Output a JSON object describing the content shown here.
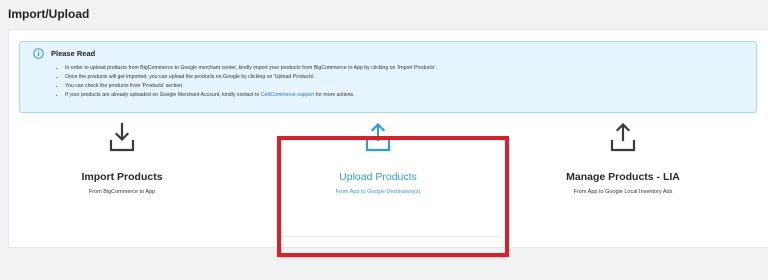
{
  "page": {
    "title": "Import/Upload"
  },
  "notice": {
    "title": "Please Read",
    "items": [
      {
        "text": "In order to upload products from BigCommerce to Google merchant center, kindly import your products from BigCommerce to App by clicking on 'Import Products'."
      },
      {
        "text": "Once the products will get imported, you can upload the products on Google by clicking on 'Upload Products'."
      },
      {
        "text": "You can check the products from 'Products' section."
      },
      {
        "text_before": "If your products are already uploaded on Google Merchant Account, kindly contact to ",
        "link": "CedCommerce support",
        "text_after": " for more actions."
      }
    ]
  },
  "actions": {
    "import": {
      "title": "Import Products",
      "subtitle": "From BigCommerce to App"
    },
    "upload": {
      "title": "Upload Products",
      "subtitle": "From App to Google Destination(s)"
    },
    "manage": {
      "title": "Manage Products - LIA",
      "subtitle": "From App to Google Local Inventory Ads"
    }
  },
  "colors": {
    "accent": "#2e9be0",
    "highlight": "#e31b23",
    "notice_bg": "#e6f4fd",
    "notice_border": "#a8d7f5",
    "icon_dark": "#3a3a3a"
  },
  "icons": {
    "info": "info-circle-icon",
    "import": "download-tray-icon",
    "upload": "upload-tray-icon",
    "manage": "upload-tray-icon"
  }
}
